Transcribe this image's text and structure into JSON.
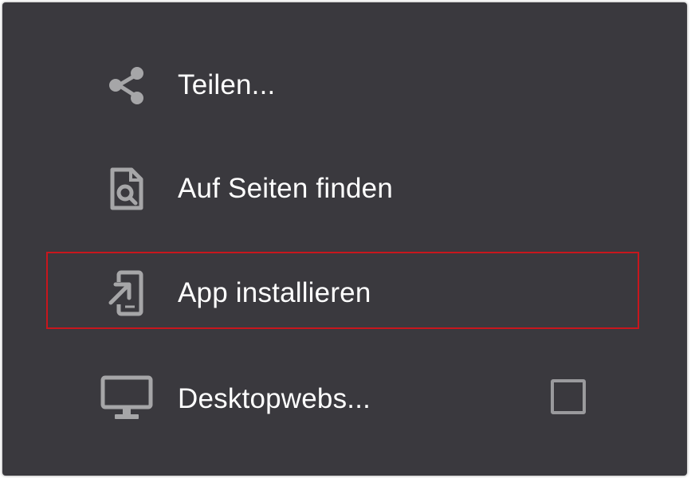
{
  "menu": {
    "items": [
      {
        "label": "Teilen...",
        "icon": "share-icon"
      },
      {
        "label": "Auf Seiten finden",
        "icon": "find-in-page-icon"
      },
      {
        "label": "App installieren",
        "icon": "install-app-icon"
      },
      {
        "label": "Desktopwebs...",
        "icon": "desktop-icon",
        "checked": false
      }
    ],
    "highlighted_item": "App installieren"
  },
  "colors": {
    "background": "#3a393e",
    "text": "#ffffff",
    "icon": "#a6a6a8",
    "highlight_border": "#c8161d"
  }
}
